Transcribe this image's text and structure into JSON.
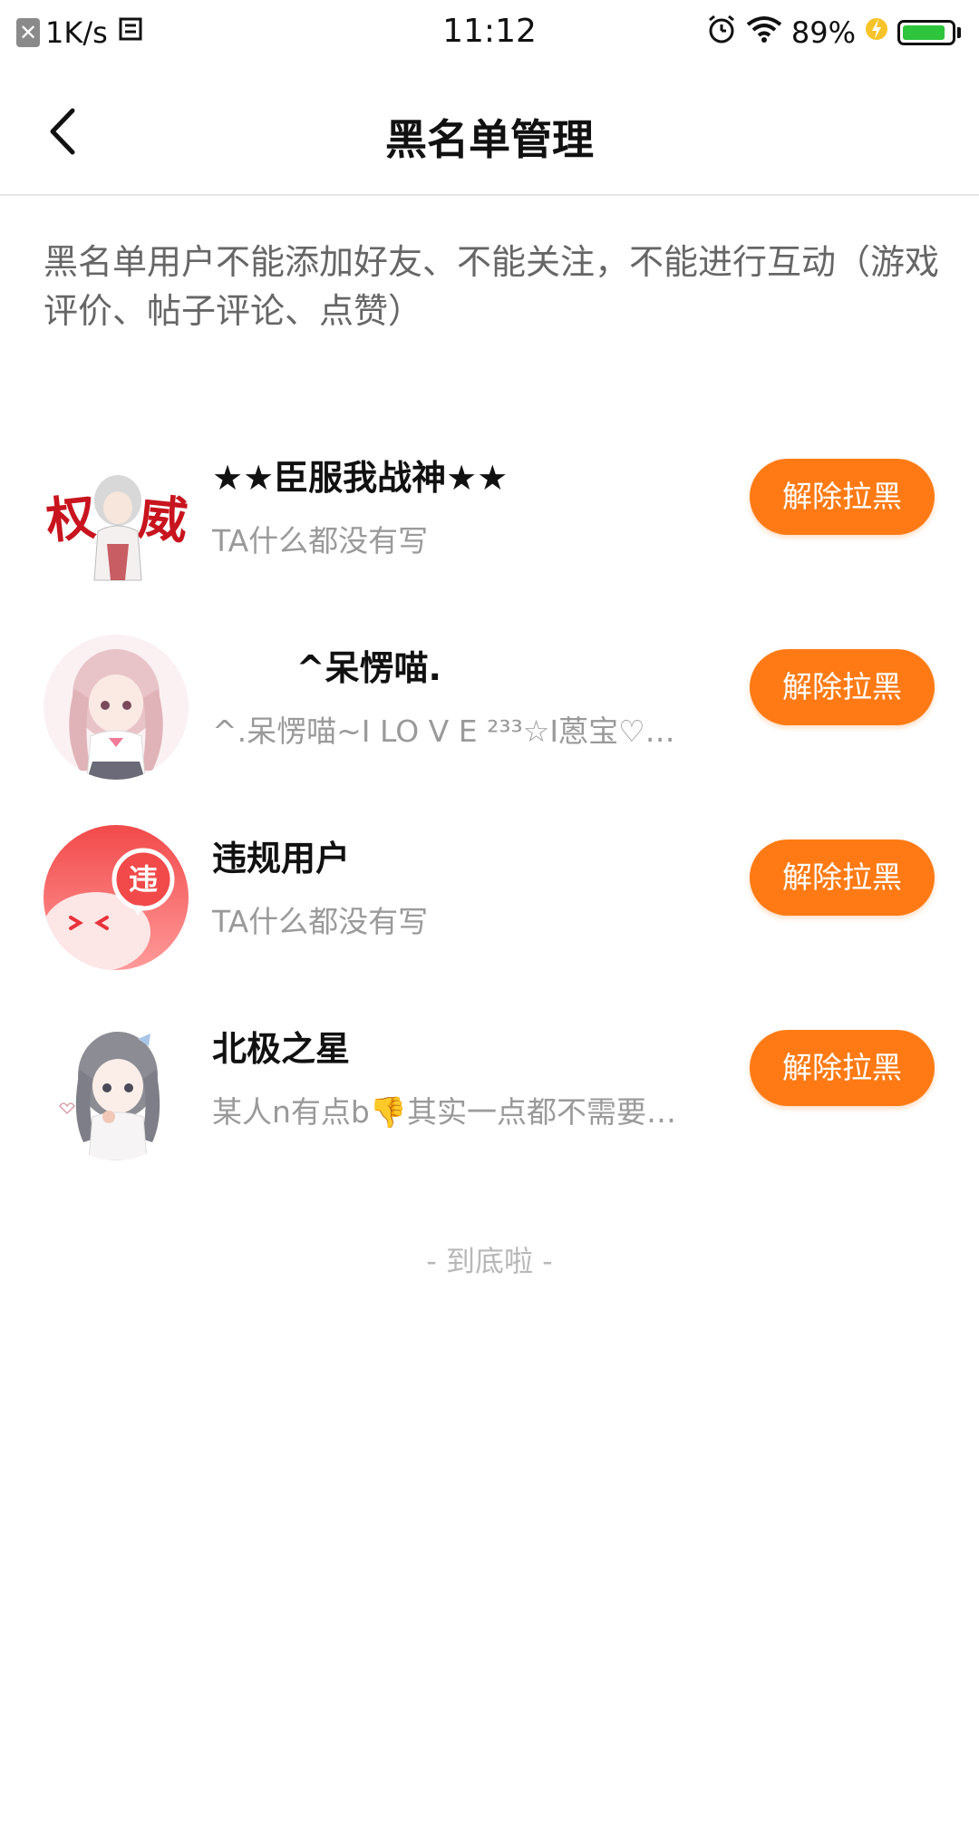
{
  "status_bar": {
    "x_badge": "✕",
    "net_speed": "1K/s",
    "time": "11:12",
    "battery_text": "89%",
    "battery_level": 0.89
  },
  "nav": {
    "back_icon": "chevron-left-icon",
    "title": "黑名单管理"
  },
  "notice": "黑名单用户不能添加好友、不能关注，不能进行互动（游戏评价、帖子评论、点赞）",
  "blocked_users": [
    {
      "name": "★★臣服我战神★★",
      "bio": "TA什么都没有写",
      "button": "解除拉黑",
      "avatar": "anime-avatar-red-calligraphy"
    },
    {
      "name": "       ^呆愣喵.",
      "bio": "^.呆愣喵~I LO V E  ²³³☆I蒽宝♡…",
      "button": "解除拉黑",
      "avatar": "anime-avatar-pink-girl"
    },
    {
      "name": "违规用户",
      "bio": "TA什么都没有写",
      "button": "解除拉黑",
      "avatar": "violation-avatar",
      "avatar_badge": "违"
    },
    {
      "name": "北极之星",
      "bio": "某人n有点b👎其实一点都不需要…",
      "button": "解除拉黑",
      "avatar": "anime-avatar-gray-girl"
    }
  ],
  "end_text": "- 到底啦 -",
  "colors": {
    "accent": "#ff7a14",
    "notice_text": "#666666",
    "bio_text": "#9a9a9a",
    "battery_fill": "#2ec43c",
    "violation_red": "#f24a4a"
  }
}
